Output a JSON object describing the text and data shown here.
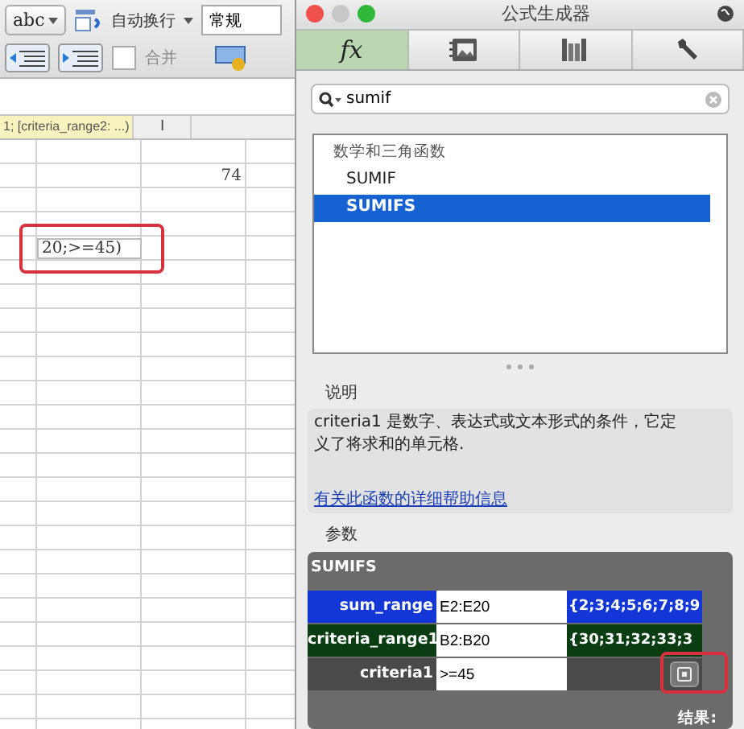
{
  "toolbar": {
    "spell_button": "abc",
    "wrap_text": "自动换行",
    "number_format": "常规",
    "merge": "合并"
  },
  "sheet": {
    "tooltip": "1; [criteria_range2: ...)",
    "column_header": "I",
    "cell_value": "74",
    "editing_cell": "20;>=45)"
  },
  "panel": {
    "title": "公式生成器",
    "tabs": [
      {
        "kind": "fx",
        "label": "fx",
        "selected": true
      },
      {
        "kind": "gallery",
        "selected": false
      },
      {
        "kind": "library",
        "selected": false
      },
      {
        "kind": "wrench",
        "selected": false
      }
    ],
    "search": {
      "value": "sumif"
    },
    "list": {
      "category": "数学和三角函数",
      "items": [
        {
          "label": "SUMIF",
          "selected": false
        },
        {
          "label": "SUMIFS",
          "selected": true
        }
      ]
    },
    "description_heading": "说明",
    "description": "criteria1 是数字、表达式或文本形式的条件，它定义了将求和的单元格.",
    "help_link": "有关此函数的详细帮助信息",
    "params_heading": "参数",
    "function_name": "SUMIFS",
    "arguments": [
      {
        "name": "sum_range",
        "value": "E2:E20",
        "result": "{2;3;4;5;6;7;8;9",
        "color": "#1237d6"
      },
      {
        "name": "criteria_range1",
        "value": "B2:B20",
        "result": "{30;31;32;33;3",
        "color": "#0b3d12"
      },
      {
        "name": "criteria1",
        "value": ">=45",
        "color": "#4a4a4a"
      }
    ],
    "result_label": "结果:"
  }
}
